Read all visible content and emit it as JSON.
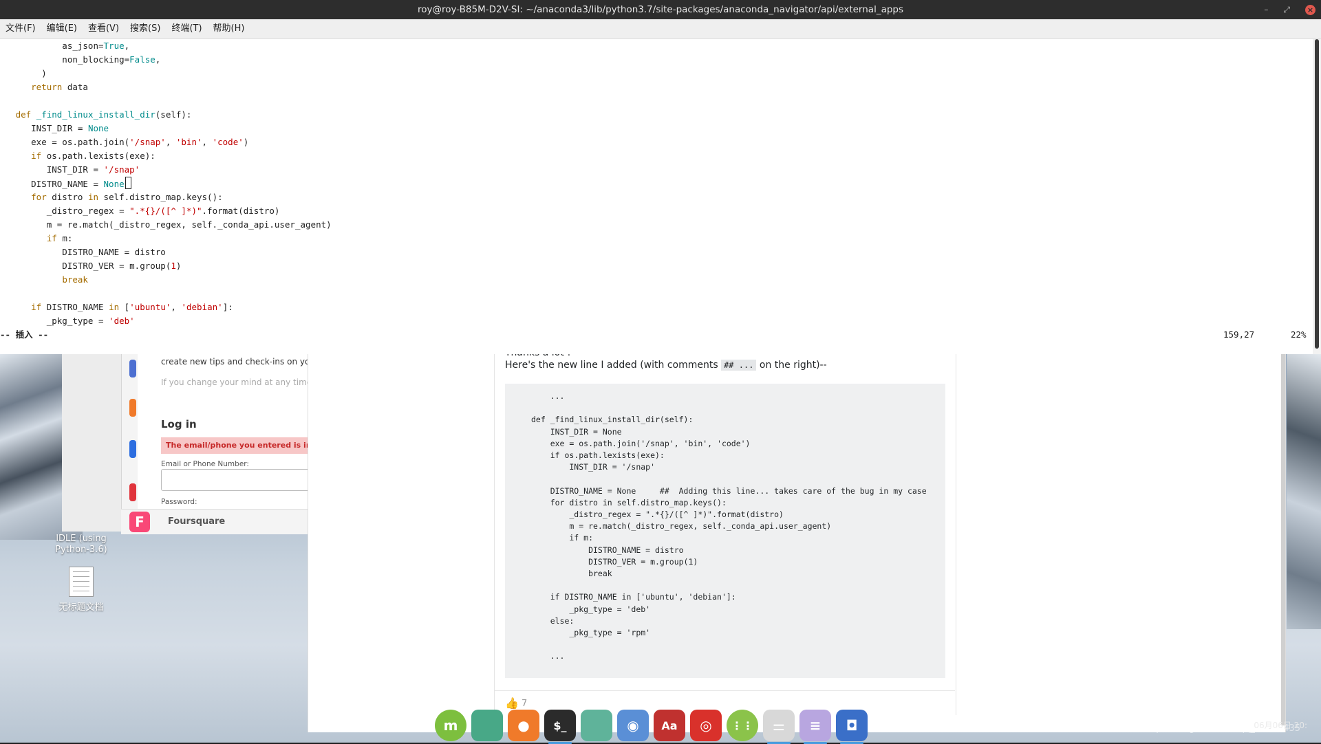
{
  "terminal": {
    "title": "roy@roy-B85M-D2V-SI: ~/anaconda3/lib/python3.7/site-packages/anaconda_navigator/api/external_apps",
    "menus": [
      "文件(F)",
      "编辑(E)",
      "查看(V)",
      "搜索(S)",
      "终端(T)",
      "帮助(H)"
    ],
    "controls": [
      "–",
      "⤢",
      "×"
    ],
    "code_lines": [
      [
        {
          "t": "            as_json="
        },
        {
          "t": "True",
          "c": "cst"
        },
        {
          "t": ","
        }
      ],
      [
        {
          "t": "            non_blocking="
        },
        {
          "t": "False",
          "c": "cst"
        },
        {
          "t": ","
        }
      ],
      [
        {
          "t": "        )"
        }
      ],
      [
        {
          "t": "      "
        },
        {
          "t": "return",
          "c": "kw"
        },
        {
          "t": " data"
        }
      ],
      [
        {
          "t": ""
        }
      ],
      [
        {
          "t": "   "
        },
        {
          "t": "def",
          "c": "kw"
        },
        {
          "t": " "
        },
        {
          "t": "_find_linux_install_dir",
          "c": "cst"
        },
        {
          "t": "(self):"
        }
      ],
      [
        {
          "t": "      INST_DIR = "
        },
        {
          "t": "None",
          "c": "cst"
        }
      ],
      [
        {
          "t": "      exe = os.path.join("
        },
        {
          "t": "'/snap'",
          "c": "str"
        },
        {
          "t": ", "
        },
        {
          "t": "'bin'",
          "c": "str"
        },
        {
          "t": ", "
        },
        {
          "t": "'code'",
          "c": "str"
        },
        {
          "t": ")"
        }
      ],
      [
        {
          "t": "      "
        },
        {
          "t": "if",
          "c": "kw"
        },
        {
          "t": " os.path.lexists(exe):"
        }
      ],
      [
        {
          "t": "         INST_DIR = "
        },
        {
          "t": "'/snap'",
          "c": "str"
        }
      ],
      [
        {
          "t": "      DISTRO_NAME = "
        },
        {
          "t": "None",
          "c": "cst"
        },
        {
          "t": "",
          "cursor": true
        }
      ],
      [
        {
          "t": "      "
        },
        {
          "t": "for",
          "c": "kw"
        },
        {
          "t": " distro "
        },
        {
          "t": "in",
          "c": "kw"
        },
        {
          "t": " self.distro_map.keys():"
        }
      ],
      [
        {
          "t": "         _distro_regex = "
        },
        {
          "t": "\".*{}/([^ ]*)\"",
          "c": "str"
        },
        {
          "t": ".format(distro)"
        }
      ],
      [
        {
          "t": "         m = re.match(_distro_regex, self._conda_api.user_agent)"
        }
      ],
      [
        {
          "t": "         "
        },
        {
          "t": "if",
          "c": "kw"
        },
        {
          "t": " m:"
        }
      ],
      [
        {
          "t": "            DISTRO_NAME = distro"
        }
      ],
      [
        {
          "t": "            DISTRO_VER = m.group("
        },
        {
          "t": "1",
          "c": "num"
        },
        {
          "t": ")"
        }
      ],
      [
        {
          "t": "            "
        },
        {
          "t": "break",
          "c": "kw"
        }
      ],
      [
        {
          "t": ""
        }
      ],
      [
        {
          "t": "      "
        },
        {
          "t": "if",
          "c": "kw"
        },
        {
          "t": " DISTRO_NAME "
        },
        {
          "t": "in",
          "c": "kw"
        },
        {
          "t": " ["
        },
        {
          "t": "'ubuntu'",
          "c": "str"
        },
        {
          "t": ", "
        },
        {
          "t": "'debian'",
          "c": "str"
        },
        {
          "t": "]:"
        }
      ],
      [
        {
          "t": "         _pkg_type = "
        },
        {
          "t": "'deb'",
          "c": "str"
        }
      ]
    ],
    "status_mode": "-- 插入 --",
    "cursor_pos": "159,27",
    "scroll_pct": "22%"
  },
  "login_window": {
    "tip_text": "create new tips and check-ins on your",
    "note_text": "If you change your mind at any time, y",
    "title": "Log in",
    "error": "The email/phone you entered is incorrect. F",
    "email_label": "Email or Phone Number:",
    "password_label": "Password:",
    "foursquare_name": "Foursquare",
    "foursquare_logo": "F"
  },
  "desktop": {
    "idle_label": "IDLE (using Python-3.6)",
    "doc_label": "无标题文档"
  },
  "post": {
    "thanks": "Thanks a lot !",
    "intro_before": "Here's the new line I added (with comments ",
    "intro_code": "## ...",
    "intro_after": " on the right)--",
    "code_lines": [
      "    ...",
      "",
      "def _find_linux_install_dir(self):",
      "    INST_DIR = None",
      "    exe = os.path.join('/snap', 'bin', 'code')",
      "    if os.path.lexists(exe):",
      "        INST_DIR = '/snap'",
      "",
      "    DISTRO_NAME = None     ##  Adding this line... takes care of the bug in my case",
      "    for distro in self.distro_map.keys():",
      "        _distro_regex = \".*{}/([^ ]*)\".format(distro)",
      "        m = re.match(_distro_regex, self._conda_api.user_agent)",
      "        if m:",
      "            DISTRO_NAME = distro",
      "            DISTRO_VER = m.group(1)",
      "            break",
      "",
      "    if DISTRO_NAME in ['ubuntu', 'debian']:",
      "        _pkg_type = 'deb'",
      "    else:",
      "        _pkg_type = 'rpm'",
      "",
      "    ..."
    ],
    "like_count": "7"
  },
  "dock": [
    {
      "name": "mint-menu-icon",
      "glyph": "m",
      "bg": "#7dbf3e",
      "round": true
    },
    {
      "name": "files-green-icon",
      "glyph": "",
      "bg": "#48a887"
    },
    {
      "name": "firefox-icon",
      "glyph": "●",
      "bg": "#f07a2a"
    },
    {
      "name": "terminal-icon",
      "glyph": "$_",
      "bg": "#2b2b2b",
      "running": true
    },
    {
      "name": "folder-icon",
      "glyph": "",
      "bg": "#5fb39a"
    },
    {
      "name": "chromium-icon",
      "glyph": "◉",
      "bg": "#5a8fd6"
    },
    {
      "name": "dictionary-icon",
      "glyph": "Aa",
      "bg": "#c0312f"
    },
    {
      "name": "netease-music-icon",
      "glyph": "◎",
      "bg": "#d9312b"
    },
    {
      "name": "app-grid-icon",
      "glyph": "⋮⋮",
      "bg": "#8bc34a",
      "round": true
    },
    {
      "name": "settings-toggle-icon",
      "glyph": "⚌",
      "bg": "#d8d8d8",
      "running": true
    },
    {
      "name": "text-editor-icon",
      "glyph": "≡",
      "bg": "#b8a6e0",
      "running": true
    },
    {
      "name": "screenshot-icon",
      "glyph": "◘",
      "bg": "#3a6fc8",
      "running": true
    }
  ],
  "tray": {
    "date_time": "06月06日 20:",
    "watermark": "https://blog.csdn.net/qq_33309435"
  }
}
